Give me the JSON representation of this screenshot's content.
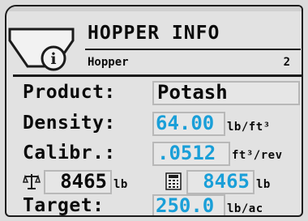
{
  "header": {
    "title": "HOPPER INFO",
    "subtitle": "Hopper",
    "hopper_number": "2",
    "icon": "hopper-info-icon"
  },
  "rows": {
    "product": {
      "label": "Product:",
      "value": "Potash"
    },
    "density": {
      "label": "Density:",
      "value": "64.00",
      "unit": "lb/ft³"
    },
    "calibration": {
      "label": "Calibr.:",
      "value": ".0512",
      "unit": "ft³/rev"
    },
    "weights": {
      "scale_icon": "scale-icon",
      "scale_value": "8465",
      "scale_unit": "lb",
      "calc_icon": "calculator-icon",
      "calc_value": "8465",
      "calc_unit": "lb"
    },
    "target": {
      "label": "Target:",
      "value": "250.0",
      "unit": "lb/ac"
    }
  },
  "colors": {
    "value_blue": "#1a9fd8",
    "text": "#0a0a0a",
    "panel": "#e2e2e2"
  }
}
